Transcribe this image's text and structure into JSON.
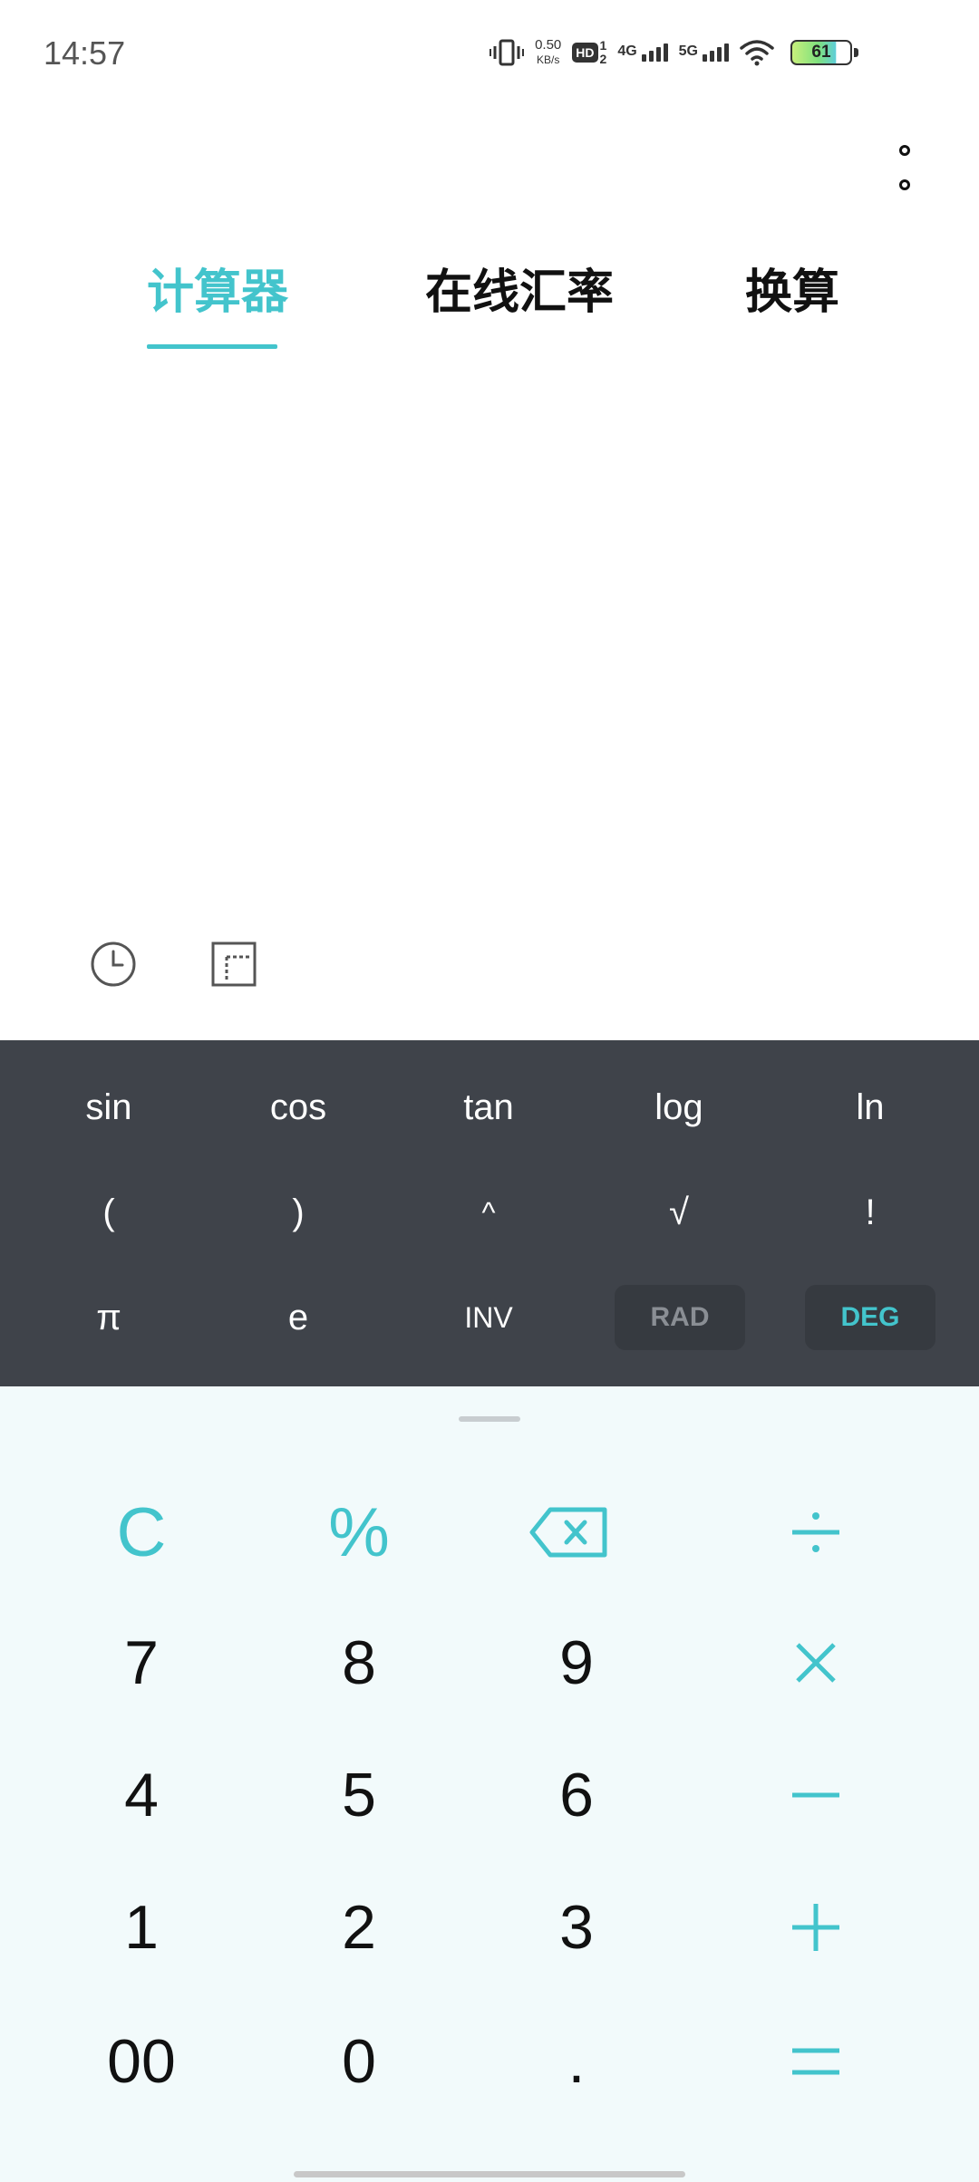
{
  "status_bar": {
    "time": "14:57",
    "net_speed_value": "0.50",
    "net_speed_unit": "KB/s",
    "hd_label": "HD",
    "hd_sub_top": "1",
    "hd_sub_bottom": "2",
    "sig1_label": "4G",
    "sig2_label": "5G",
    "battery_level": "61",
    "icons": [
      "vibrate-icon",
      "hd-icon",
      "signal-4g-icon",
      "signal-5g-icon",
      "wifi-icon",
      "battery-icon"
    ]
  },
  "header": {
    "more_icon": "more-vertical-icon"
  },
  "tabs": [
    {
      "label": "计算器",
      "active": true
    },
    {
      "label": "在线汇率",
      "active": false
    },
    {
      "label": "换算",
      "active": false
    }
  ],
  "tools": {
    "history_icon": "history-clock-icon",
    "layout_icon": "layout-toggle-icon"
  },
  "scientific": {
    "row1": [
      "sin",
      "cos",
      "tan",
      "log",
      "ln"
    ],
    "row2": [
      "(",
      ")",
      "^",
      "√",
      "!"
    ],
    "row3": [
      "π",
      "e",
      "INV",
      "RAD",
      "DEG"
    ],
    "active_mode": "DEG"
  },
  "keypad": {
    "row1": [
      "C",
      "%",
      "⌫",
      "÷"
    ],
    "row2": [
      "7",
      "8",
      "9",
      "×"
    ],
    "row3": [
      "4",
      "5",
      "6",
      "−"
    ],
    "row4": [
      "1",
      "2",
      "3",
      "+"
    ],
    "row5": [
      "00",
      "0",
      ".",
      "="
    ]
  },
  "colors": {
    "accent": "#43c4cc",
    "sci_panel_bg": "#3f434a",
    "keypad_bg": "#f2fafb"
  }
}
